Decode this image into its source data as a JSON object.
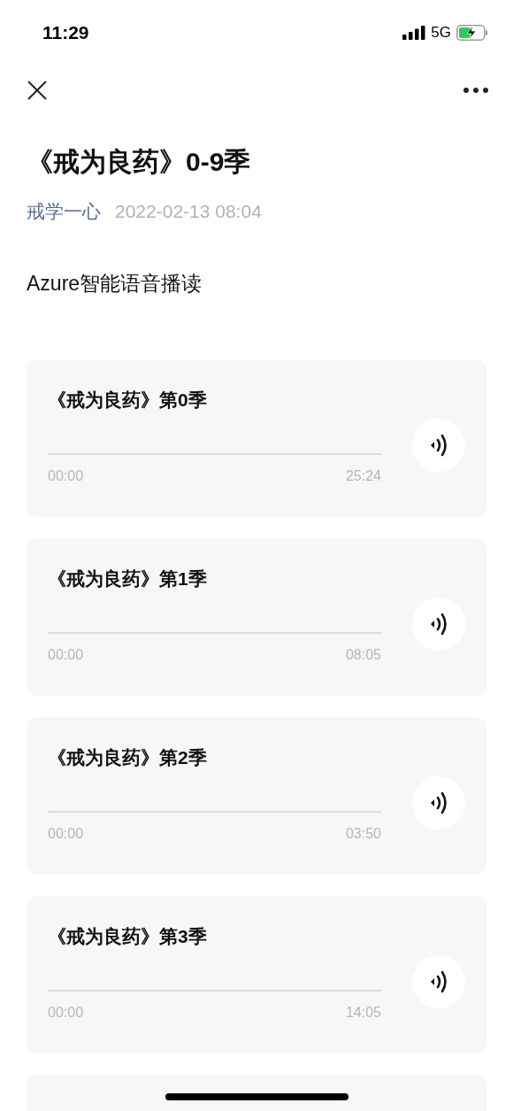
{
  "status_bar": {
    "time": "11:29",
    "network": "5G"
  },
  "article": {
    "title": "《戒为良药》0-9季",
    "author": "戒学一心",
    "date": "2022-02-13 08:04",
    "intro": "Azure智能语音播读"
  },
  "audio_tracks": [
    {
      "title": "《戒为良药》第0季",
      "current": "00:00",
      "duration": "25:24",
      "level": 0
    },
    {
      "title": "《戒为良药》第1季",
      "current": "00:00",
      "duration": "08:05",
      "level": 0
    },
    {
      "title": "《戒为良药》第2季",
      "current": "00:00",
      "duration": "03:50",
      "level": 0
    },
    {
      "title": "《戒为良药》第3季",
      "current": "00:00",
      "duration": "14:05",
      "level": 0
    }
  ]
}
